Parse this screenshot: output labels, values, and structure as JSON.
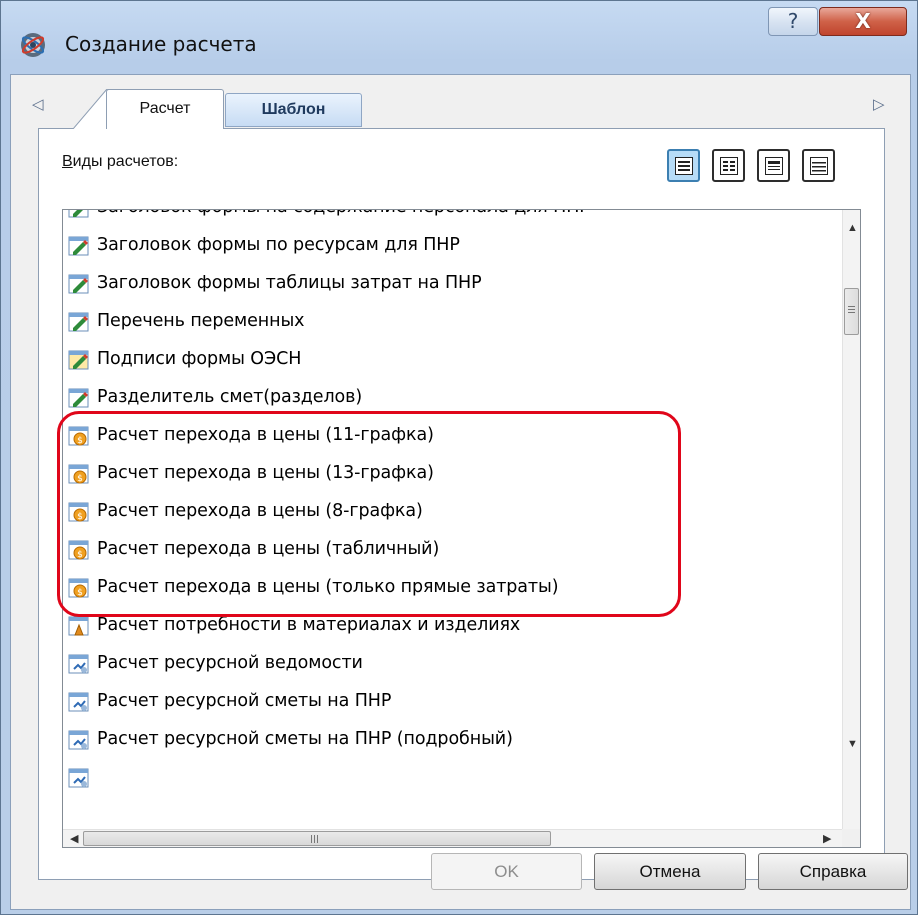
{
  "window": {
    "title": "Создание расчета",
    "help_glyph": "?",
    "close_glyph": "X"
  },
  "tabs": {
    "left_arrow": "◁",
    "right_arrow": "▷",
    "items": [
      {
        "label": "Расчет",
        "active": true
      },
      {
        "label": "Шаблон",
        "active": false
      }
    ]
  },
  "view_label": {
    "underlined": "В",
    "rest": "иды расчетов:"
  },
  "view_modes": [
    "large-icons-view",
    "small-icons-view",
    "list-view",
    "details-view"
  ],
  "list": {
    "items": [
      {
        "label": "Заголовок формы на содержание персонала для ПНР",
        "icon": "edit-form-icon"
      },
      {
        "label": "Заголовок формы по ресурсам для ПНР",
        "icon": "edit-form-icon"
      },
      {
        "label": "Заголовок формы таблицы затрат на ПНР",
        "icon": "edit-form-icon"
      },
      {
        "label": "Перечень переменных",
        "icon": "edit-form-icon"
      },
      {
        "label": "Подписи формы ОЭСН",
        "icon": "sign-form-icon"
      },
      {
        "label": "Разделитель смет(разделов)",
        "icon": "edit-form-icon"
      },
      {
        "label": "Расчет перехода в цены (11-графка)",
        "icon": "price-calc-icon"
      },
      {
        "label": "Расчет перехода в цены (13-графка)",
        "icon": "price-calc-icon"
      },
      {
        "label": "Расчет перехода в цены (8-графка)",
        "icon": "price-calc-icon"
      },
      {
        "label": "Расчет перехода в цены (табличный)",
        "icon": "price-calc-icon"
      },
      {
        "label": "Расчет перехода в цены (только прямые затраты)",
        "icon": "price-calc-icon"
      },
      {
        "label": "Расчет потребности в материалах и изделиях",
        "icon": "materials-icon"
      },
      {
        "label": "Расчет ресурсной ведомости",
        "icon": "resource-calc-icon"
      },
      {
        "label": "Расчет ресурсной сметы на ПНР",
        "icon": "resource-calc-icon"
      },
      {
        "label": "Расчет ресурсной сметы на ПНР (подробный)",
        "icon": "resource-calc-icon"
      },
      {
        "label": "",
        "icon": "resource-calc-icon"
      }
    ],
    "h_grip": "III"
  },
  "buttons": {
    "ok": "OK",
    "cancel": "Отмена",
    "help": "Справка"
  },
  "colors": {
    "highlight": "#e0061a",
    "title_gradient_top": "#c6daf2",
    "close_red": "#c0452d"
  }
}
